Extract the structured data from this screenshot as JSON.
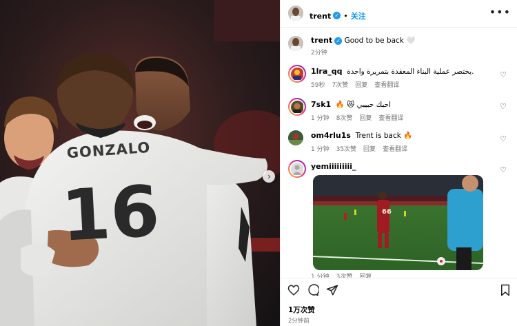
{
  "post": {
    "author": "trent",
    "follow_label": "关注",
    "separator": "•",
    "more_label": "•••",
    "likes": "1万次赞",
    "time": "2分钟前",
    "jersey_name": "GONZALO",
    "jersey_number": "16"
  },
  "caption": {
    "username": "trent",
    "text": "Good to be back 🤍",
    "time": "2分钟"
  },
  "comments": [
    {
      "username": "1lra_qq",
      "text": "يختصر عملية البناء المعقدة بتمريرة واحدة.",
      "time": "59秒",
      "likes": "7次赞",
      "reply": "回复",
      "translate": "查看翻译"
    },
    {
      "username": "7sk1",
      "text": "🔥 😻 احبك حبيبي",
      "time": "1 分钟",
      "likes": "8次赞",
      "reply": "回复",
      "translate": "查看翻译"
    },
    {
      "username": "om4rlu1s",
      "text": "Trent is back 🔥",
      "time": "1 分钟",
      "likes": "35次赞",
      "reply": "回复",
      "translate": "查看翻译"
    },
    {
      "username": "yemiiiiiiiii_",
      "text": "",
      "time": "1 分钟",
      "likes": "3次赞",
      "reply": "回复",
      "translate": ""
    }
  ],
  "video": {
    "shirt_number": "66"
  },
  "colors": {
    "link_blue": "#0095f6",
    "verified_blue": "#1d9bf0",
    "meta_gray": "#737373"
  }
}
